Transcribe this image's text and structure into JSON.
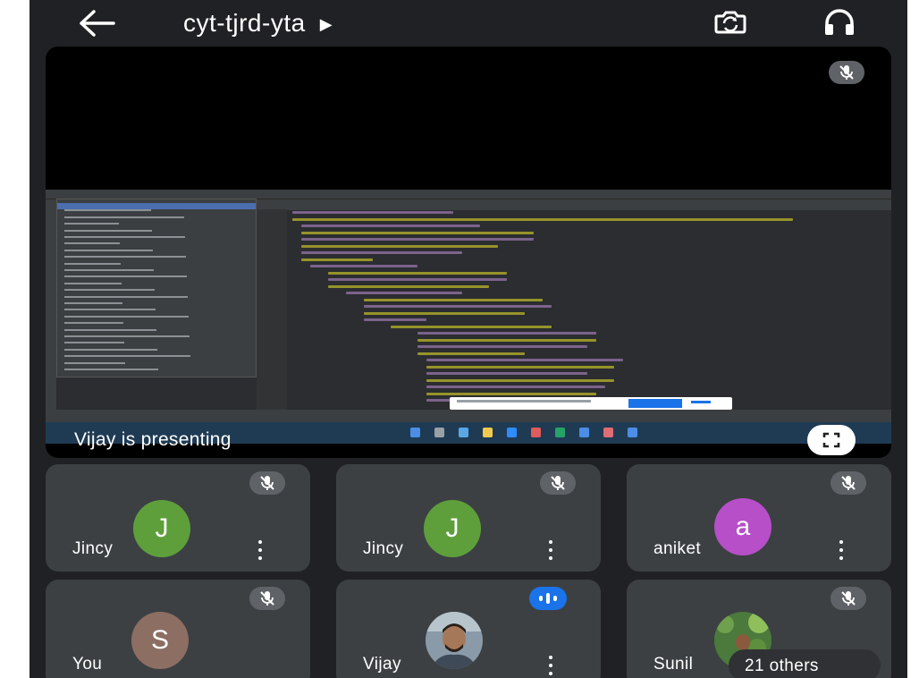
{
  "top_bar": {
    "meeting_code": "cyt-tjrd-yta",
    "back_icon": "arrow-left-icon",
    "switch_camera_icon": "switch-camera-icon",
    "audio_icon": "headphones-icon"
  },
  "presentation": {
    "label": "Vijay is presenting",
    "mic_state": "muted",
    "fullscreen_icon": "fullscreen-icon",
    "shared_screen": "Android Studio IDE (screen share)"
  },
  "participants": [
    {
      "name": "Jincy",
      "initial": "J",
      "avatar_color": "#5e9f3b",
      "mic_state": "muted"
    },
    {
      "name": "Jincy",
      "initial": "J",
      "avatar_color": "#5e9f3b",
      "mic_state": "muted"
    },
    {
      "name": "aniket",
      "initial": "a",
      "avatar_color": "#b64fc8",
      "mic_state": "muted"
    },
    {
      "name": "You",
      "initial": "S",
      "avatar_color": "#8d6e63",
      "mic_state": "muted"
    },
    {
      "name": "Vijay",
      "initial": "",
      "avatar_color": "#6d5a4c",
      "mic_state": "speaking"
    },
    {
      "name": "Sunil",
      "initial": "",
      "avatar_color": "#3f6b3a",
      "mic_state": "muted"
    }
  ],
  "others_chip": {
    "label": "21 others"
  },
  "colors": {
    "background": "#202124",
    "tile": "#3c4043",
    "mute_chip": "#5f6368",
    "speaking": "#1a73e8"
  }
}
